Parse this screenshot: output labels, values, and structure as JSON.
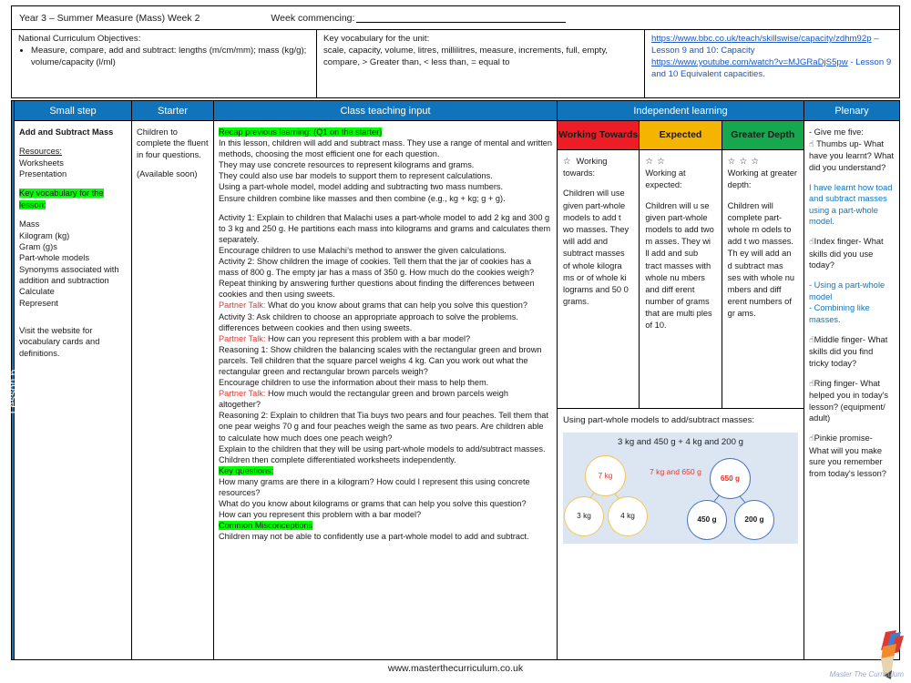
{
  "header": {
    "title": "Year 3 – Summer Measure (Mass)  Week 2",
    "week_commencing_label": "Week commencing:",
    "nc_label": "National Curriculum Objectives:",
    "nc_items": [
      "Measure, compare, add and subtract: lengths (m/cm/mm); mass (kg/g); volume/capacity (l/ml)"
    ],
    "key_vocab_label": "Key vocabulary for the unit:",
    "key_vocab_text": "scale, capacity, volume, litres, millilitres, measure, increments, full, empty, compare, > Greater than, < less than, = equal to",
    "links": [
      {
        "url": "https://www.bbc.co.uk/teach/skillswise/capacity/zdhm92p",
        "suffix": " – Lesson 9 and 10: Capacity"
      },
      {
        "url": "https://www.youtube.com/watch?v=MJGRaDjS5pw",
        "suffix": " - Lesson 9 and 10 Equivalent capacities."
      }
    ]
  },
  "spine": {
    "label": "Lesson 6"
  },
  "columns": {
    "small_step": "Small step",
    "starter": "Starter",
    "class_teaching": "Class teaching input",
    "independent": "Independent learning",
    "plenary": "Plenary"
  },
  "small_step": {
    "title": "Add and Subtract Mass",
    "resources_label": "Resources:",
    "resources": [
      "Worksheets",
      "Presentation"
    ],
    "key_vocab_heading": "Key vocabulary for the lesson:",
    "vocab": [
      "Mass",
      "Kilogram (kg)",
      "Gram (g)s",
      "Part-whole models",
      "Synonyms associated with addition and subtraction",
      "Calculate",
      "Represent"
    ],
    "footer_note": "Visit the website for vocabulary cards and definitions."
  },
  "starter": {
    "lines": [
      "Children to complete the fluent in four questions."
    ],
    "note": "(Available soon)"
  },
  "class_teaching": {
    "recap_heading": "Recap previous learning: (Q1 on the starter)",
    "intro": [
      "In this lesson, children will add and subtract mass. They use a range of mental and written methods, choosing the most efficient one for each question.",
      "They may use concrete resources to represent kilograms and grams.",
      "They  could also use bar models to support them to represent calculations.",
      "Using a part-whole model, model adding and subtracting two mass numbers.",
      "Ensure children combine like masses and then combine (e.g., kg + kg; g + g)."
    ],
    "activity1": "Activity 1:  Explain to children that Malachi uses a part-whole model to add 2 kg and 300 g to 3 kg and 250 g. He partitions each mass into kilograms and grams and calculates them separately.",
    "activity1_follow": "Encourage children to use Malachi’s method to answer the given calculations.",
    "activity2": "Activity 2:  Show children the image of cookies. Tell them that the jar of cookies has a mass of 800 g.  The empty jar has a mass of 350 g.  How much do the cookies weigh?",
    "activity2_follow": "Repeat thinking by answering further questions about finding the differences between cookies and then using sweets.",
    "partner_talk_label": "Partner Talk:",
    "partner_talk_1": " What do you know about grams that can help you solve this question?",
    "activity3": "Activity 3: Ask children to choose an appropriate approach to solve the problems. differences between cookies and then using sweets.",
    "partner_talk_2": " How can you represent this problem with a bar model?",
    "reasoning1": "Reasoning 1: Show children the balancing scales with the rectangular green and brown parcels. Tell children that the square parcel weighs 4 kg. Can you work out what the rectangular green and rectangular brown parcels weigh?",
    "reasoning1_follow": "Encourage children to use the information about their mass to help them.",
    "partner_talk_3": " How much would the rectangular green and brown parcels weigh altogether?",
    "reasoning2": "Reasoning 2: Explain to children that Tia buys two pears and four peaches. Tell them that one pear weighs 70 g and four peaches weigh the same as two pears. Are children able to calculate how much does one peach weigh?",
    "explain": "Explain to the children that they will be using part-whole models to add/subtract masses.",
    "independent_note": "Children then complete differentiated worksheets independently.",
    "key_questions_heading": "Key questions:",
    "key_questions": [
      "How many grams are there in a kilogram? How could I represent this using concrete resources?",
      "What do you know about kilograms or grams that can help you solve this question?",
      "How can you represent this problem with a bar model?"
    ],
    "misconceptions_heading": "Common Misconceptions",
    "misconceptions": "Children may not be able to confidently use a part-whole model to add and subtract."
  },
  "independent": {
    "working_towards": {
      "header": "Working Towards",
      "stars": "☆",
      "subtitle": "Working towards:",
      "body": "Children will use given part-whole models to add t wo masses. They will add and subtract masses of whole kilogra ms or of whole ki lograms and 50 0 grams.",
      "color": "#ee1c25"
    },
    "expected": {
      "header": "Expected",
      "stars": "☆ ☆",
      "subtitle": "Working at expected:",
      "body": "Children will u se given part-whole models to add two m asses. They  wi ll add and sub tract masses with whole nu mbers and diff erent number of grams that are multi ples of 10.",
      "color": "#f5b400"
    },
    "greater_depth": {
      "header": "Greater Depth",
      "stars": "☆ ☆ ☆",
      "subtitle": "Working at greater depth:",
      "body": "Children will complete  part-whole m odels to add t wo masses. Th ey  will add an d subtract mas ses with whole nu mbers and diff erent numbers of gr ams.",
      "color": "#16a84e"
    },
    "diagram": {
      "caption": "Using part-whole models to add/subtract masses:",
      "equation": "3 kg and 450 g + 4 kg and 200 g",
      "answer": "7 kg and 650 g",
      "left_tree": {
        "whole": "7 kg",
        "parts": [
          "3 kg",
          "4 kg"
        ],
        "color": "#f6c453"
      },
      "right_tree": {
        "whole": "650 g",
        "parts": [
          "450 g",
          "200 g"
        ],
        "color": "#4472c4"
      }
    }
  },
  "plenary": {
    "intro": "- Give me five:",
    "items": [
      {
        "icon": "hand-thumbs-up-icon",
        "prompt": "Thumbs up- What have you learnt? What did you understand?",
        "answer": "I have learnt how toad and subtract masses using a part-whole model."
      },
      {
        "icon": "hand-index-finger-icon",
        "prompt": "Index finger- What skills did you use today?",
        "answer": "- Using a part-whole model\n- Combining like masses."
      },
      {
        "icon": "hand-middle-finger-icon",
        "prompt": "Middle finger- What skills did you find tricky today?",
        "answer": ""
      },
      {
        "icon": "hand-ring-finger-icon",
        "prompt": "Ring finger- What helped you in today's lesson? (equipment/ adult)",
        "answer": ""
      },
      {
        "icon": "hand-pinkie-icon",
        "prompt": "Pinkie promise- What will you make sure you remember from today's lesson?",
        "answer": ""
      }
    ]
  },
  "footer": {
    "website": "www.masterthecurriculum.co.uk",
    "logo_caption": "Master The Curriculum"
  },
  "colors": {
    "brand_blue": "#1074bc",
    "highlight_green": "#00ff00",
    "red": "#ee1c25",
    "amber": "#f5b400",
    "green": "#16a84e",
    "link_blue": "#1a56c4"
  }
}
